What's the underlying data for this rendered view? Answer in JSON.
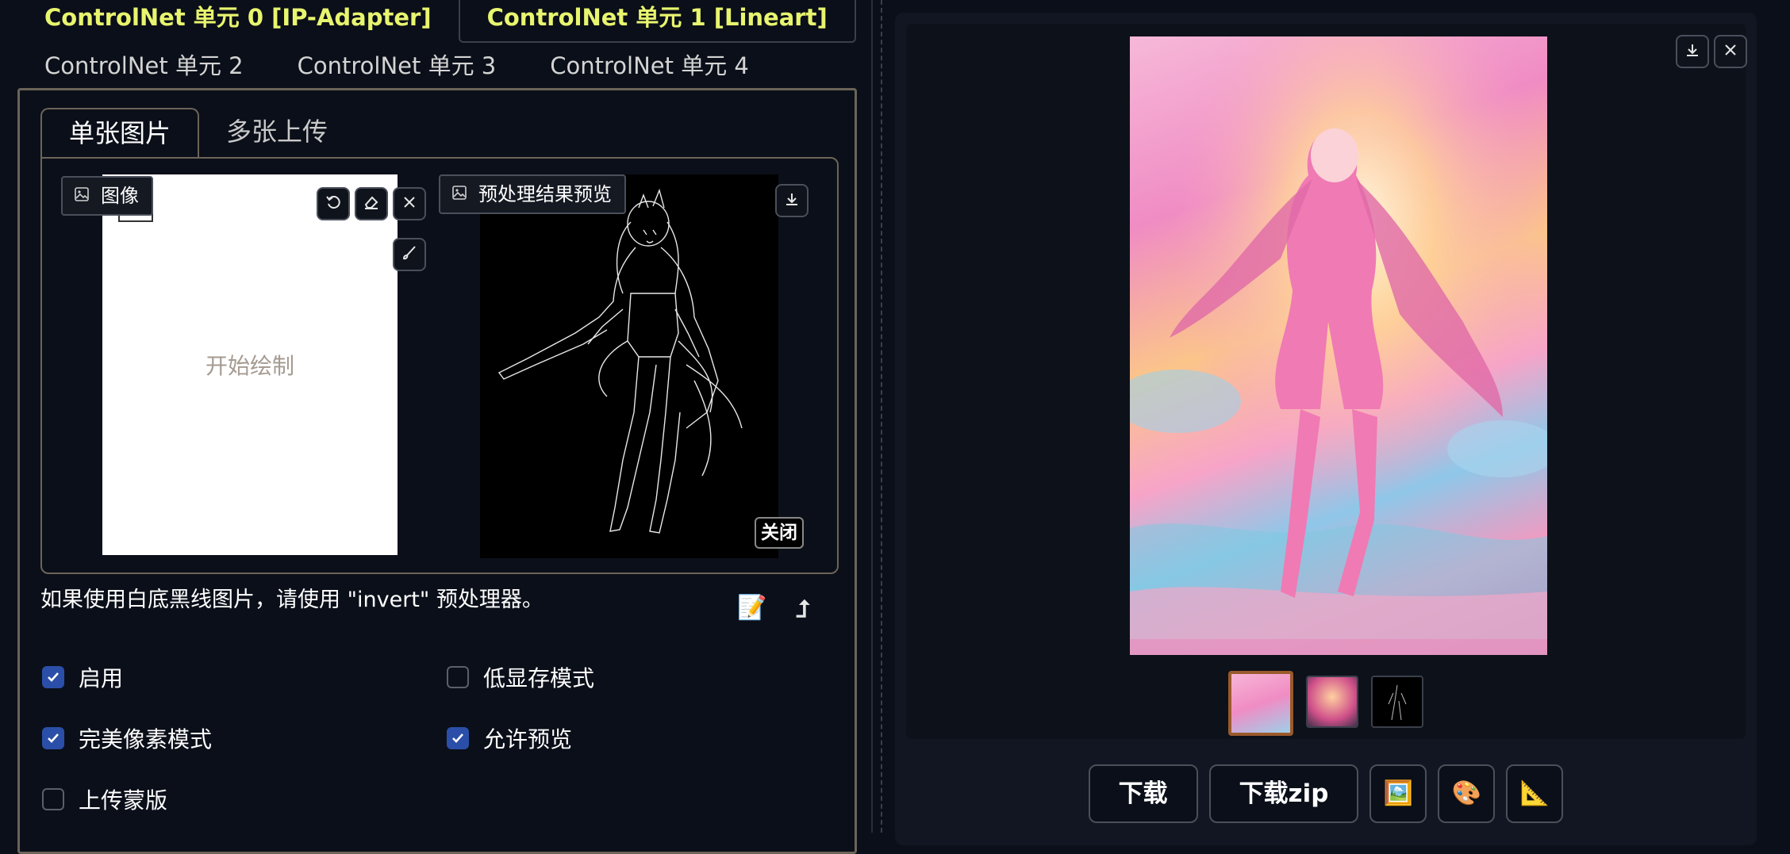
{
  "controlnet_tabs_row1": [
    "ControlNet 单元 0 [IP-Adapter]",
    "ControlNet 单元 1 [Lineart]"
  ],
  "controlnet_tabs_row2": [
    "ControlNet 单元 2",
    "ControlNet 单元 3",
    "ControlNet 单元 4"
  ],
  "image_tabs": [
    "单张图片",
    "多张上传"
  ],
  "image_input": {
    "label": "图像",
    "canvas_hint": "开始绘制"
  },
  "preview": {
    "label": "预处理结果预览",
    "close_label": "关闭"
  },
  "hint_text": "如果使用白底黑线图片，请使用 \"invert\" 预处理器。",
  "hint_icons": {
    "edit": "📝",
    "send": "⮥"
  },
  "checkboxes": {
    "enable": {
      "label": "启用",
      "checked": true
    },
    "low_vram": {
      "label": "低显存模式",
      "checked": false
    },
    "pixel_perfect": {
      "label": "完美像素模式",
      "checked": true
    },
    "allow_preview": {
      "label": "允许预览",
      "checked": true
    },
    "upload_mask": {
      "label": "上传蒙版",
      "checked": false
    }
  },
  "gallery": {
    "buttons": {
      "download": "下载",
      "download_zip": "下载zip",
      "send_img": "🖼️",
      "send_paint": "🎨",
      "send_extras": "📐"
    },
    "thumb_count": 3
  },
  "colors": {
    "active_tab": "#e8f56e",
    "checkbox": "#2b4fa8",
    "panel_border": "#6b6458",
    "selected_thumb": "#9a5a2c"
  }
}
